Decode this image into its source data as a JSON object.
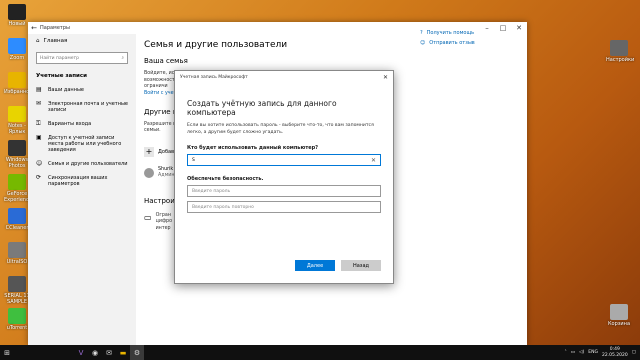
{
  "desktop": {
    "icons": [
      {
        "label": "Новый",
        "color": "#222"
      },
      {
        "label": "Zoom",
        "color": "#2d8cff"
      },
      {
        "label": "Избранное",
        "color": "#e8b400"
      },
      {
        "label": "Notes - Ярлык",
        "color": "#e8d400"
      },
      {
        "label": "Windows Photos",
        "color": "#333"
      },
      {
        "label": "GeForce Experience",
        "color": "#76b900"
      },
      {
        "label": "CCleaner",
        "color": "#2a6bd6"
      },
      {
        "label": "UltraISO",
        "color": "#7a7a7a"
      },
      {
        "label": "SERIAL 11 SAMPLE",
        "color": "#555"
      },
      {
        "label": "uTorrent",
        "color": "#3fbf3f"
      },
      {
        "label": "Корзина",
        "color": "#aaaaaa"
      },
      {
        "label": "Настройки",
        "color": "#666"
      }
    ]
  },
  "settings": {
    "window_title": "Параметры",
    "sidebar": {
      "home": "Главная",
      "search_placeholder": "Найти параметр",
      "section": "Учетные записи",
      "items": [
        {
          "label": "Ваши данные",
          "icon": "person-card-icon"
        },
        {
          "label": "Электронная почта и учетные записи",
          "icon": "mail-icon"
        },
        {
          "label": "Варианты входа",
          "icon": "key-icon"
        },
        {
          "label": "Доступ к учетной записи места работы или учебного заведения",
          "icon": "briefcase-icon"
        },
        {
          "label": "Семья и другие пользователи",
          "icon": "people-icon"
        },
        {
          "label": "Синхронизация ваших параметров",
          "icon": "sync-icon"
        }
      ]
    },
    "main": {
      "title": "Семья и другие пользователи",
      "family_heading": "Ваша семья",
      "family_text": "Войдите, использ просматри возможност защиты детей ограничи",
      "family_link": "Войти с учетной",
      "other_heading": "Другие по",
      "other_text": "Разрешите вход систему с под семьи.",
      "add_label": "Добав",
      "user_name": "Shurik",
      "user_role": "Админ",
      "kiosk_heading": "Настроить",
      "kiosk_text": "Огран цифро интер"
    },
    "right_links": [
      "Получить помощь",
      "Отправить отзыв"
    ]
  },
  "dialog": {
    "title": "Учетная запись Майкрософт",
    "heading": "Создать учётную запись для данного компьютера",
    "description": "Если вы хотите использовать пароль - выберите что-то, что вам запомнится легко, а другим будет сложно угадать.",
    "username_label": "Кто будет использовать данный компьютер?",
    "username_value": "S",
    "security_label": "Обеспечьте безопасность.",
    "password_placeholder": "Введите пароль",
    "password_repeat_placeholder": "Введите пароль повторно",
    "next_button": "Далее",
    "back_button": "Назад"
  },
  "taskbar": {
    "clock_time": "0:49",
    "clock_date": "22.05.2020",
    "language": "ENG"
  }
}
